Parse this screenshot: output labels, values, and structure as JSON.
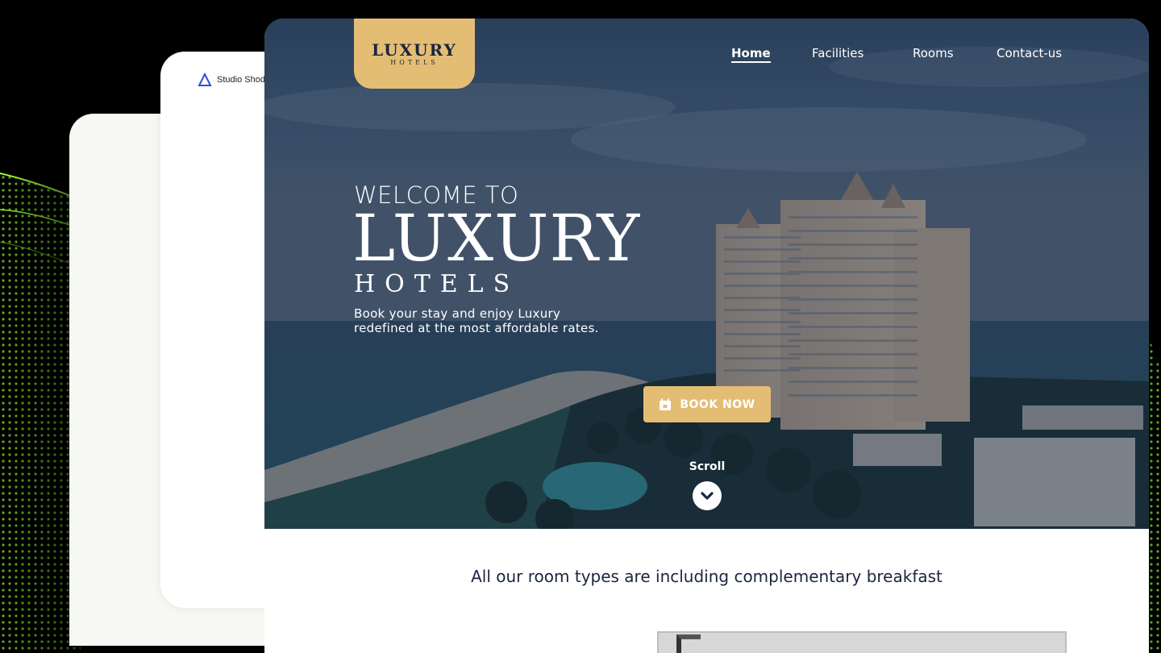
{
  "studio": {
    "name": "Studio Shod"
  },
  "logo": {
    "title": "LUXURY",
    "subtitle": "HOTELS"
  },
  "nav": {
    "items": [
      {
        "label": "Home",
        "active": true
      },
      {
        "label": "Facilities",
        "active": false
      },
      {
        "label": "Rooms",
        "active": false
      },
      {
        "label": "Contact-us",
        "active": false
      }
    ]
  },
  "hero": {
    "welcome": "WELCOME TO",
    "title": "LUXURY",
    "subtitle": "HOTELS",
    "tagline_line1": "Book your stay and enjoy Luxury",
    "tagline_line2": "redefined at the most affordable rates.",
    "book_button": "BOOK NOW",
    "scroll_label": "Scroll"
  },
  "section": {
    "heading": "All our room types are including complementary breakfast"
  },
  "colors": {
    "accent": "#e4bd74",
    "navy": "#1b2540",
    "wave": "#7bd12b"
  },
  "icons": {
    "book": "calendar-icon",
    "scroll": "chevron-down-icon",
    "studio": "triangle-logo-icon"
  }
}
